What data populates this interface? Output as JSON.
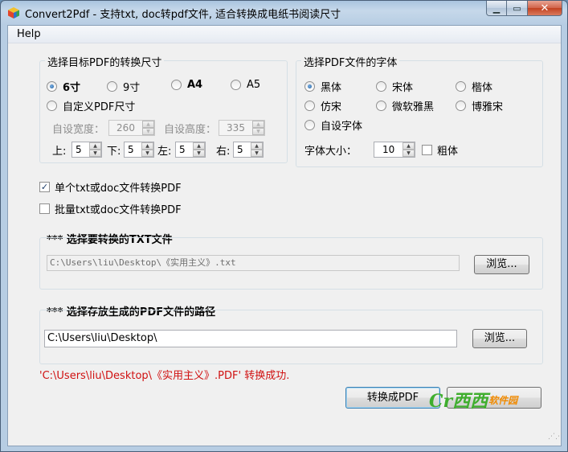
{
  "window": {
    "title": "Convert2Pdf - 支持txt, doc转pdf文件, 适合转换成电纸书阅读尺寸",
    "app_icon": "colorful-cube-icon",
    "minimize_glyph": "▁",
    "maximize_glyph": "▭",
    "close_glyph": "✕"
  },
  "menu": {
    "help": "Help"
  },
  "size_group": {
    "title": "选择目标PDF的转换尺寸",
    "options": [
      {
        "label": "6寸",
        "selected": true,
        "bold": true
      },
      {
        "label": "9寸",
        "selected": false,
        "bold": false
      },
      {
        "label": "A4",
        "selected": false,
        "bold": true
      },
      {
        "label": "A5",
        "selected": false,
        "bold": false
      }
    ],
    "custom_label": "自定义PDF尺寸",
    "custom_width_label": "自设宽度：",
    "custom_width_value": "260",
    "custom_height_label": "自设高度：",
    "custom_height_value": "335",
    "margins": [
      {
        "label": "上:",
        "value": "5"
      },
      {
        "label": "下:",
        "value": "5"
      },
      {
        "label": "左:",
        "value": "5"
      },
      {
        "label": "右:",
        "value": "5"
      }
    ]
  },
  "font_group": {
    "title": "选择PDF文件的字体",
    "options": [
      {
        "label": "黑体",
        "selected": true
      },
      {
        "label": "宋体",
        "selected": false
      },
      {
        "label": "楷体",
        "selected": false
      },
      {
        "label": "仿宋",
        "selected": false
      },
      {
        "label": "微软雅黑",
        "selected": false
      },
      {
        "label": "博雅宋",
        "selected": false
      },
      {
        "label": "自设字体",
        "selected": false
      }
    ],
    "size_label": "字体大小：",
    "size_value": "10",
    "bold_label": "粗体",
    "bold_checked": false
  },
  "mode": {
    "single_label": "单个txt或doc文件转换PDF",
    "single_checked": true,
    "batch_label": "批量txt或doc文件转换PDF",
    "batch_checked": false
  },
  "source": {
    "title": "*** 选择要转换的TXT文件",
    "path": "C:\\Users\\liu\\Desktop\\《实用主义》.txt",
    "browse_label": "浏览..."
  },
  "output": {
    "title": "*** 选择存放生成的PDF文件的路径",
    "path": "C:\\Users\\liu\\Desktop\\",
    "browse_label": "浏览..."
  },
  "status_message": "'C:\\Users\\liu\\Desktop\\《实用主义》.PDF' 转换成功.",
  "convert_label": "转换成PDF",
  "watermark": {
    "logo": "Cr西西",
    "text": "软件园"
  },
  "colors": {
    "status": "#d01010",
    "titlebar": "#b7cde3",
    "close": "#c2411f"
  }
}
